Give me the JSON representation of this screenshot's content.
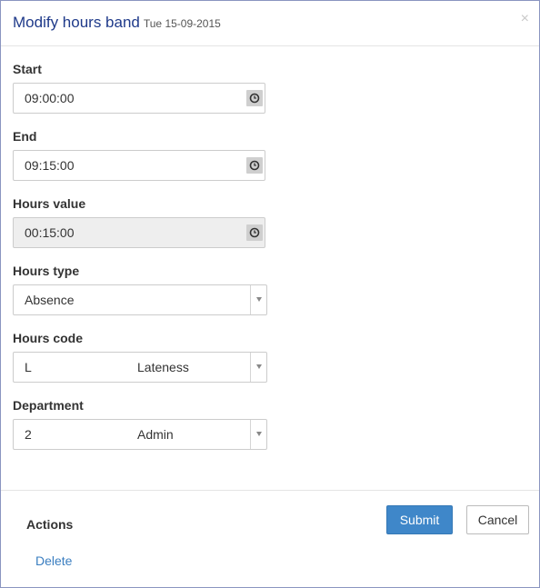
{
  "header": {
    "title": "Modify hours band",
    "date": "Tue 15-09-2015",
    "close_label": "×"
  },
  "form": {
    "start": {
      "label": "Start",
      "value": "09:00:00",
      "icon": "clock-icon"
    },
    "end": {
      "label": "End",
      "value": "09:15:00",
      "icon": "clock-icon"
    },
    "hours_value": {
      "label": "Hours value",
      "value": "00:15:00",
      "icon": "clock-icon",
      "disabled": true
    },
    "hours_type": {
      "label": "Hours type",
      "selected": "Absence"
    },
    "hours_code": {
      "label": "Hours code",
      "selected_code": "L",
      "selected_name": "Lateness"
    },
    "department": {
      "label": "Department",
      "selected_code": "2",
      "selected_name": "Admin"
    }
  },
  "footer": {
    "actions_label": "Actions",
    "delete_label": "Delete",
    "submit_label": "Submit",
    "cancel_label": "Cancel"
  },
  "colors": {
    "title": "#1f3a8a",
    "primary_button": "#3f87c9",
    "link": "#3a7ec0",
    "disabled_field": "#eeeeee"
  }
}
